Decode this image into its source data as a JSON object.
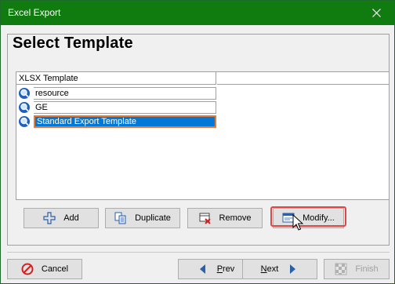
{
  "window": {
    "title": "Excel Export",
    "close_glyph": "✕"
  },
  "page": {
    "heading": "Select Template"
  },
  "list": {
    "column_header": "XLSX Template",
    "items": [
      {
        "label": "resource",
        "icon": "magnifier-icon",
        "selected": false
      },
      {
        "label": "GE",
        "icon": "magnifier-icon",
        "selected": false
      },
      {
        "label": "Standard Export Template",
        "icon": "magnifier-icon",
        "selected": true
      }
    ]
  },
  "actions": {
    "add": "Add",
    "duplicate": "Duplicate",
    "remove": "Remove",
    "modify": "Modify..."
  },
  "footer": {
    "cancel": "Cancel",
    "prev_underlined": "P",
    "prev_rest": "rev",
    "next_underlined": "N",
    "next_rest": "ext",
    "finish": "Finish"
  },
  "colors": {
    "titlebar": "#107c10",
    "selection": "#0078d7",
    "selection_border": "#e07b39",
    "highlight_border": "#e04646"
  }
}
